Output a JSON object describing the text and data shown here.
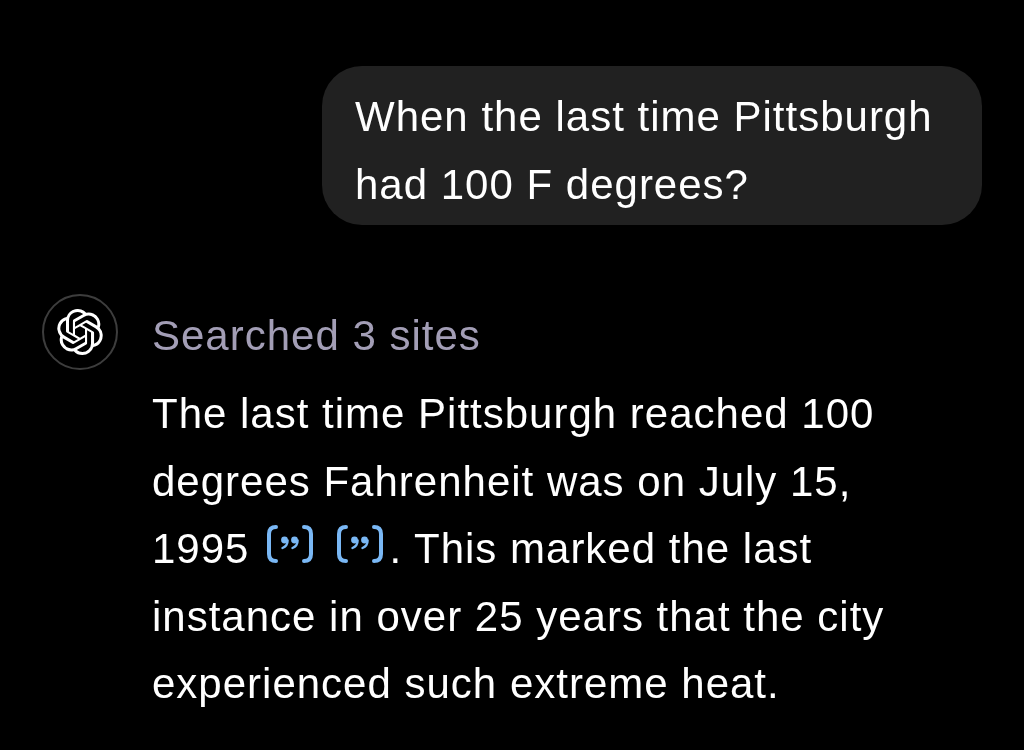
{
  "user_message": {
    "text": "When the last time Pittsburgh had 100 F degrees?"
  },
  "assistant_message": {
    "status": "Searched 3 sites",
    "answer": [
      {
        "kind": "text",
        "text": "The last time Pittsburgh reached 100 degrees Fahrenheit was on July 15, 1995"
      },
      {
        "kind": "citation"
      },
      {
        "kind": "citation"
      },
      {
        "kind": "text",
        "text": ". This marked the last instance in over 25 years that the city experienced such extreme heat."
      }
    ]
  }
}
